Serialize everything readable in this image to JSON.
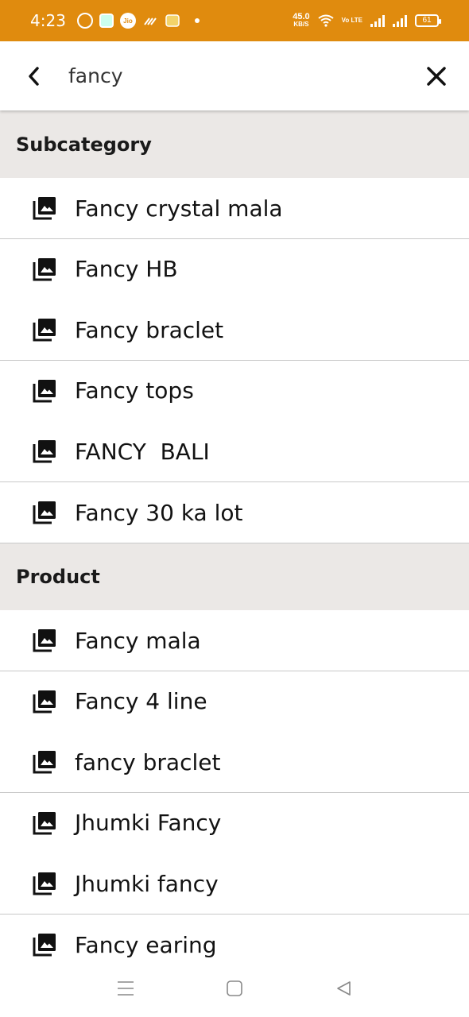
{
  "status_bar": {
    "time": "4:23",
    "speed_value": "45.0",
    "speed_unit": "KB/S",
    "volte": "Vo LTE",
    "battery": "61",
    "color": "#e08b0e"
  },
  "search": {
    "query": "fancy",
    "back_icon": "chevron-left-icon",
    "close_icon": "close-icon"
  },
  "sections": {
    "subcategory": {
      "title": "Subcategory",
      "items": [
        {
          "label": "Fancy crystal mala"
        },
        {
          "label": "Fancy HB"
        },
        {
          "label": "Fancy braclet"
        },
        {
          "label": "Fancy tops"
        },
        {
          "label": "FANCY  BALI"
        },
        {
          "label": "Fancy 30 ka lot"
        }
      ]
    },
    "product": {
      "title": "Product",
      "items": [
        {
          "label": "Fancy mala"
        },
        {
          "label": "Fancy 4 line"
        },
        {
          "label": "fancy braclet"
        },
        {
          "label": "Jhumki Fancy"
        },
        {
          "label": "Jhumki fancy"
        },
        {
          "label": "Fancy earing"
        }
      ]
    }
  },
  "row_icon": "photo-library-icon",
  "nav": {
    "menu_icon": "menu-icon",
    "home_icon": "home-square-icon",
    "back_icon": "back-triangle-icon"
  }
}
